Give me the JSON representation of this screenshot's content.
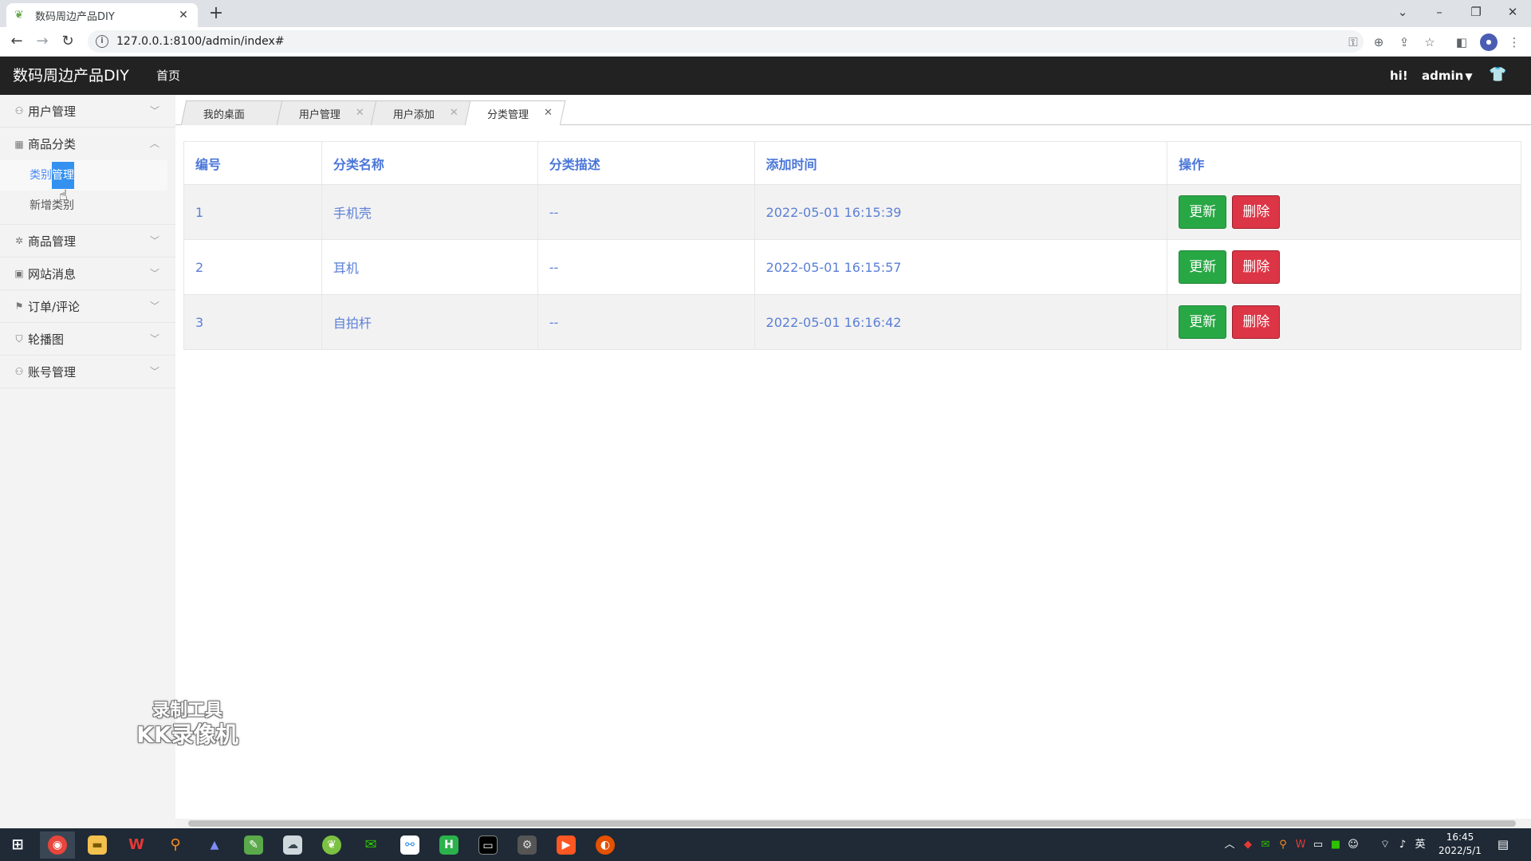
{
  "browser": {
    "tab_title": "数码周边产品DIY",
    "tab_close": "✕",
    "new_tab": "+",
    "url": "127.0.0.1:8100/admin/index#"
  },
  "header": {
    "brand": "数码周边产品DIY",
    "nav_home": "首页",
    "greeting": "hi!",
    "user": "admin"
  },
  "sidebar": {
    "menus": [
      {
        "label": "用户管理",
        "icon": "user-icon"
      },
      {
        "label": "商品分类",
        "icon": "grid-icon"
      },
      {
        "label": "商品管理",
        "icon": "gear-icon"
      },
      {
        "label": "网站消息",
        "icon": "image-icon"
      },
      {
        "label": "订单/评论",
        "icon": "flag-icon"
      },
      {
        "label": "轮播图",
        "icon": "bag-icon"
      },
      {
        "label": "账号管理",
        "icon": "user-icon"
      }
    ],
    "submenu": [
      {
        "label_a": "类别",
        "label_b": "管理"
      },
      {
        "label": "新增类别"
      }
    ]
  },
  "content_tabs": [
    {
      "label": "我的桌面"
    },
    {
      "label": "用户管理"
    },
    {
      "label": "用户添加"
    },
    {
      "label": "分类管理"
    }
  ],
  "table": {
    "headers": [
      "编号",
      "分类名称",
      "分类描述",
      "添加时间",
      "操作"
    ],
    "rows": [
      {
        "id": "1",
        "name": "手机壳",
        "desc": "--",
        "time": "2022-05-01 16:15:39"
      },
      {
        "id": "2",
        "name": "耳机",
        "desc": "--",
        "time": "2022-05-01 16:15:57"
      },
      {
        "id": "3",
        "name": "自拍杆",
        "desc": "--",
        "time": "2022-05-01 16:16:42"
      }
    ],
    "update_label": "更新",
    "delete_label": "删除"
  },
  "watermark": {
    "line1": "录制工具",
    "line2": "KK录像机"
  },
  "taskbar": {
    "tray_lang": "英",
    "time": "16:45",
    "date": "2022/5/1"
  },
  "colors": {
    "header_bg": "#222222",
    "sidebar_bg": "#f3f3f3",
    "link_blue": "#5b7fd6",
    "update_green": "#28a745",
    "delete_red": "#dc3545"
  }
}
